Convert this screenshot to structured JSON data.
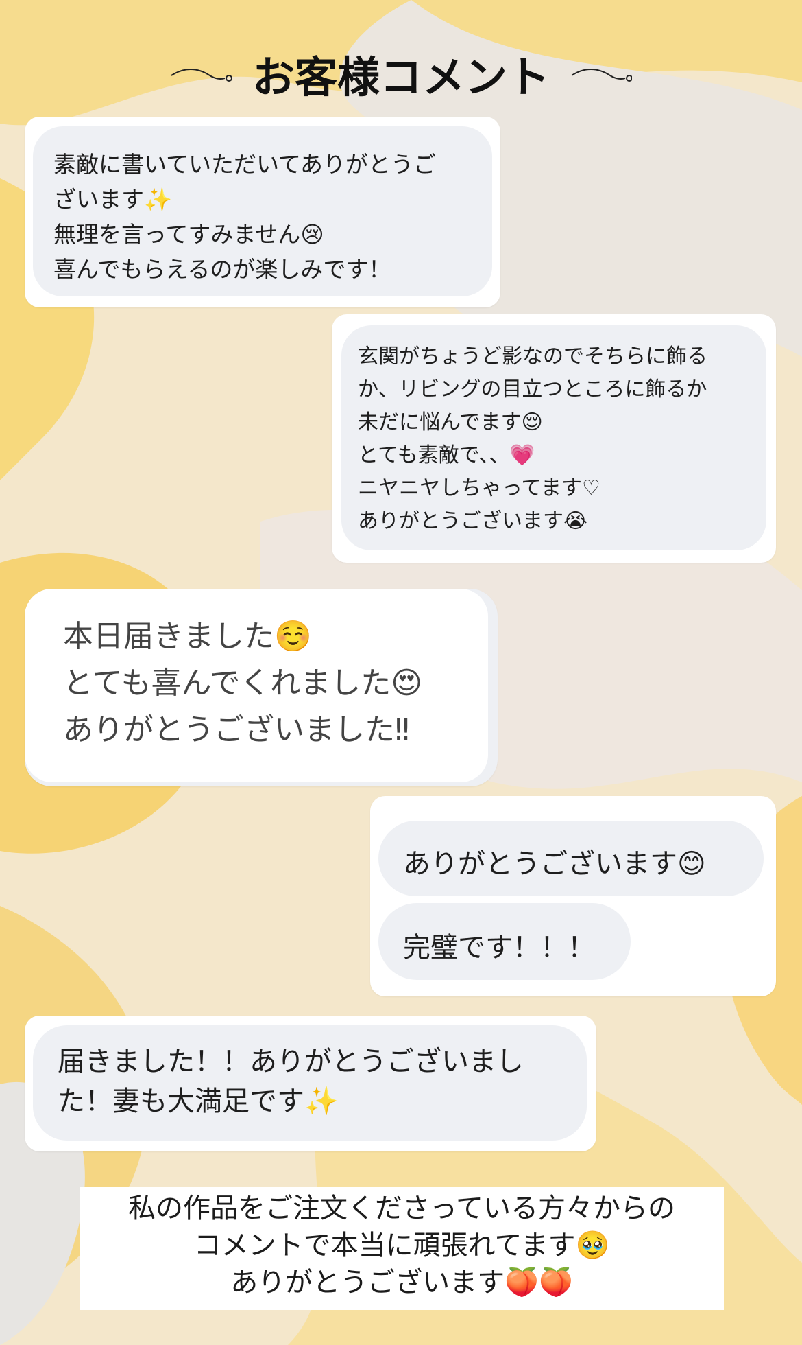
{
  "title": "お客様コメント",
  "comments": [
    {
      "lines": [
        "素敵に書いていただいてありがとうご",
        "ざいます✨",
        "無理を言ってすみません😢",
        "喜んでもらえるのが楽しみです！"
      ]
    },
    {
      "lines": [
        "玄関がちょうど影なのでそちらに飾る",
        "か、リビングの目立つところに飾るか",
        "未だに悩んでます😌",
        "とても素敵で、、💗",
        "ニヤニヤしちゃってます♡",
        "ありがとうございます😭"
      ]
    },
    {
      "lines": [
        "本日届きました☺️",
        "とても喜んでくれました😍",
        "ありがとうございました‼︎"
      ]
    },
    {
      "bubble1": "ありがとうございます😊",
      "bubble2": "完璧です！！！"
    },
    {
      "lines": [
        "届きました！！ありがとうございまし",
        "た！妻も大満足です✨"
      ]
    }
  ],
  "footer": {
    "lines": [
      "私の作品をご注文くださっている方々からの",
      "コメントで本当に頑張れてます🥹",
      "ありがとうございます🍑🍑"
    ]
  },
  "colors": {
    "background": "#f3e6c8",
    "card": "#ffffff",
    "bubble": "#eef0f4",
    "swirl_yellow": "#f6d77a",
    "swirl_grey": "#e4e4e2"
  }
}
